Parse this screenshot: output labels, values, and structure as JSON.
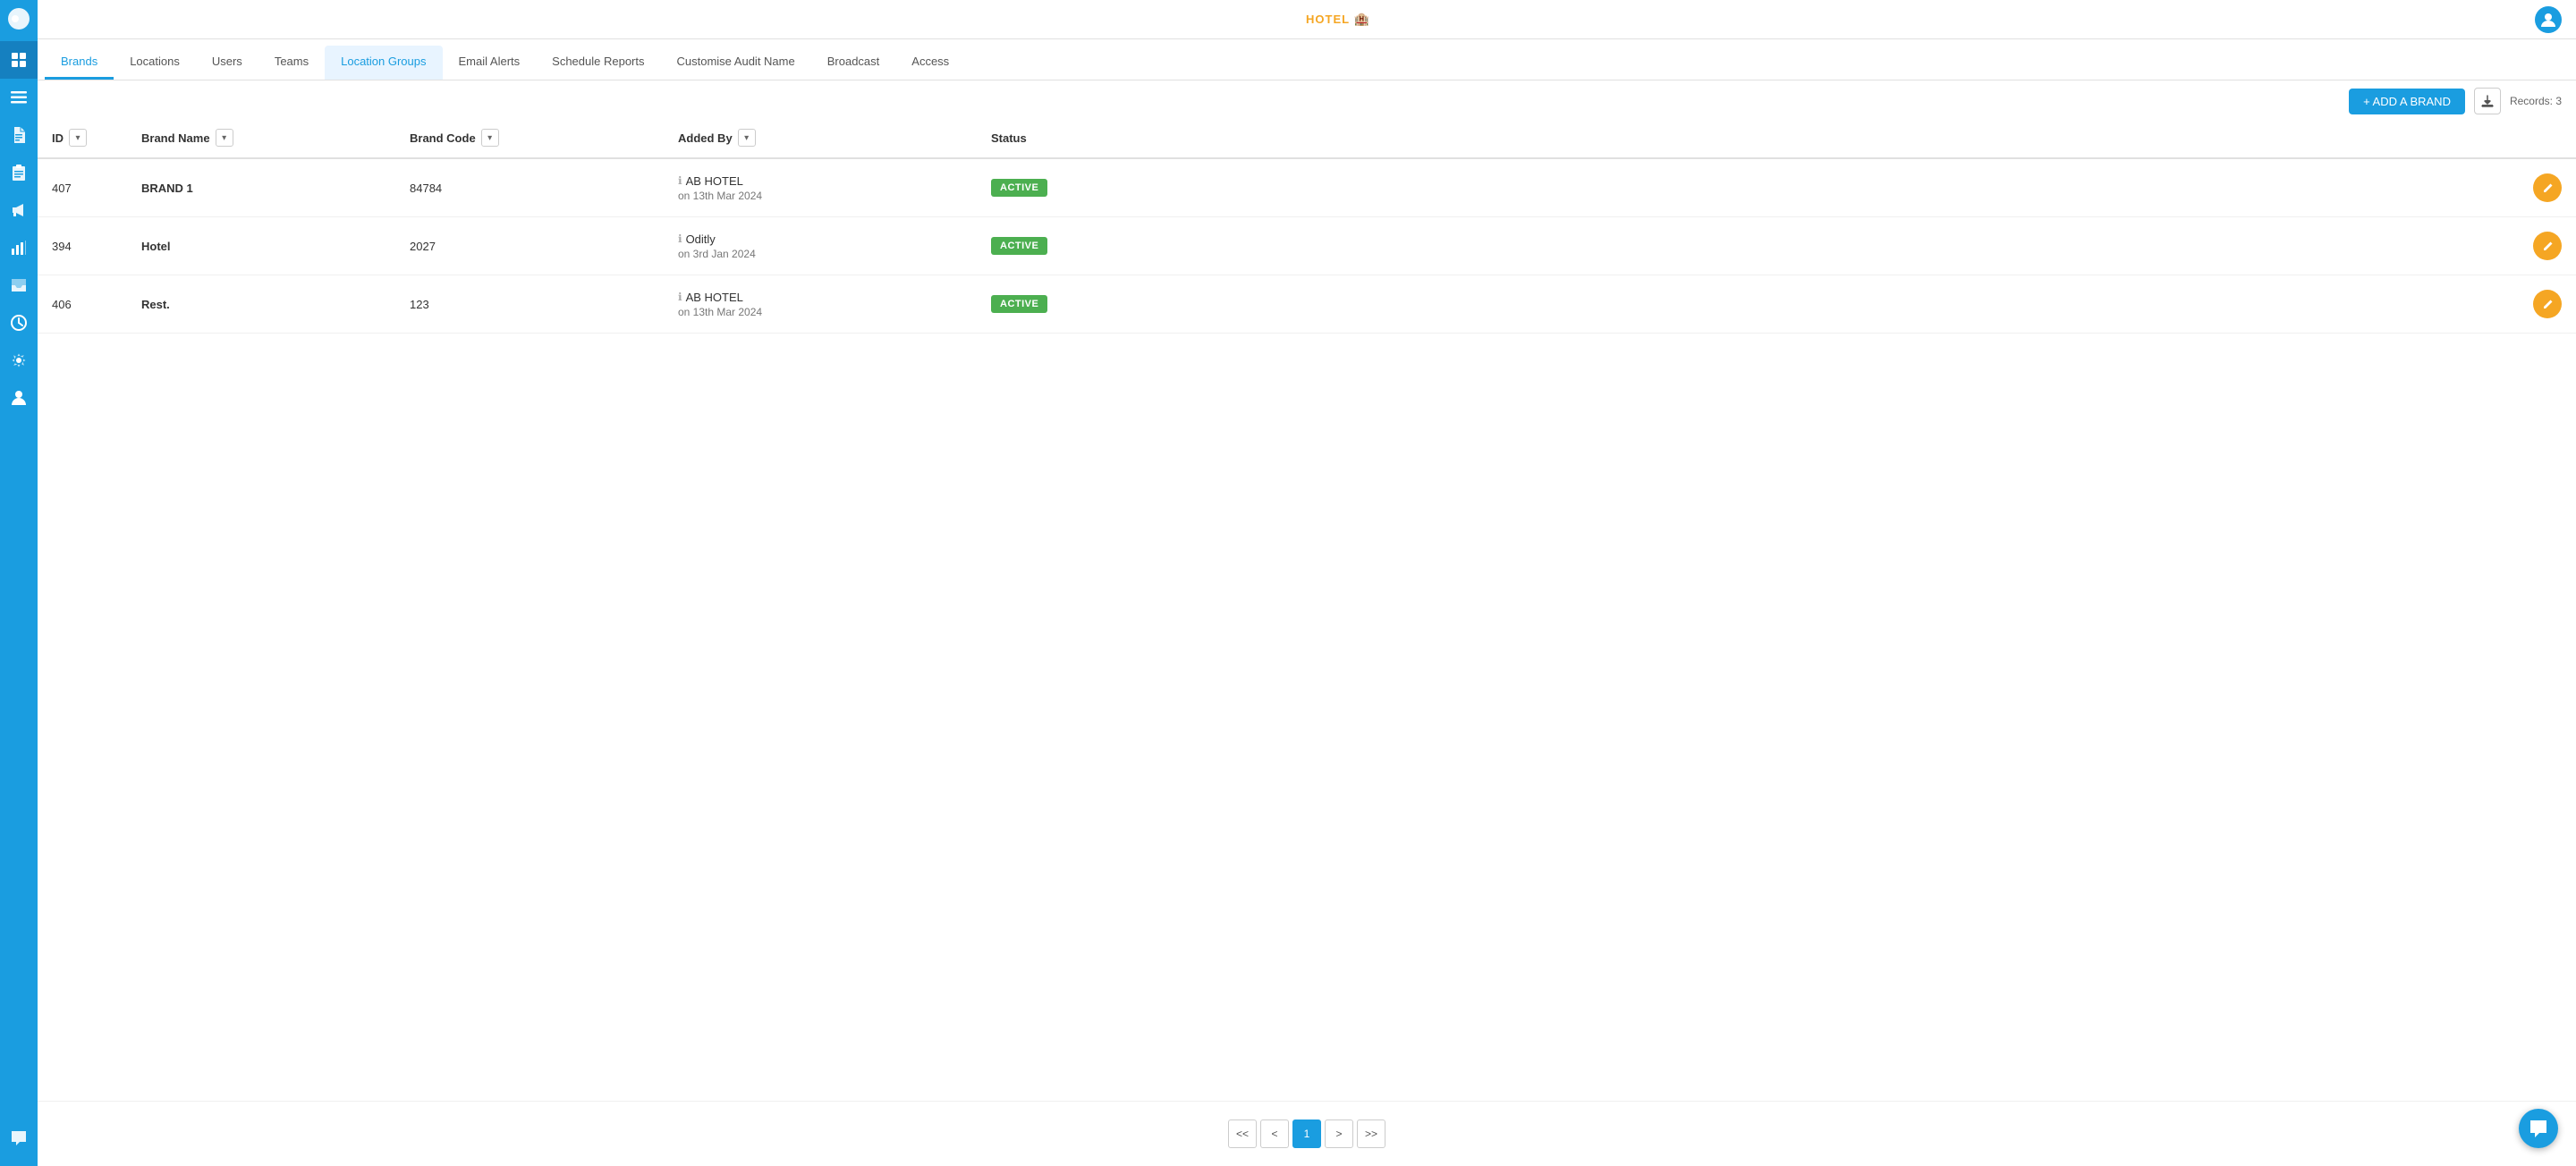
{
  "app": {
    "logo_text": "HOTEL",
    "logo_sub": "🏨"
  },
  "nav": {
    "tabs": [
      {
        "id": "brands",
        "label": "Brands",
        "active": true,
        "highlighted": false
      },
      {
        "id": "locations",
        "label": "Locations",
        "active": false,
        "highlighted": false
      },
      {
        "id": "users",
        "label": "Users",
        "active": false,
        "highlighted": false
      },
      {
        "id": "teams",
        "label": "Teams",
        "active": false,
        "highlighted": false
      },
      {
        "id": "location-groups",
        "label": "Location Groups",
        "active": false,
        "highlighted": true
      },
      {
        "id": "email-alerts",
        "label": "Email Alerts",
        "active": false,
        "highlighted": false
      },
      {
        "id": "schedule-reports",
        "label": "Schedule Reports",
        "active": false,
        "highlighted": false
      },
      {
        "id": "customise-audit-name",
        "label": "Customise Audit Name",
        "active": false,
        "highlighted": false
      },
      {
        "id": "broadcast",
        "label": "Broadcast",
        "active": false,
        "highlighted": false
      },
      {
        "id": "access",
        "label": "Access",
        "active": false,
        "highlighted": false
      }
    ]
  },
  "toolbar": {
    "add_brand_label": "+ ADD A BRAND",
    "records_label": "Records: 3",
    "download_icon": "⬇"
  },
  "table": {
    "columns": [
      {
        "id": "id",
        "label": "ID"
      },
      {
        "id": "brand-name",
        "label": "Brand Name"
      },
      {
        "id": "brand-code",
        "label": "Brand Code"
      },
      {
        "id": "added-by",
        "label": "Added By"
      },
      {
        "id": "status",
        "label": "Status"
      }
    ],
    "rows": [
      {
        "id": "407",
        "brand_name": "BRAND 1",
        "brand_code": "84784",
        "added_by_name": "AB HOTEL",
        "added_by_date": "on 13th Mar 2024",
        "status": "ACTIVE"
      },
      {
        "id": "394",
        "brand_name": "Hotel",
        "brand_code": "2027",
        "added_by_name": "Oditly",
        "added_by_date": "on 3rd Jan 2024",
        "status": "ACTIVE"
      },
      {
        "id": "406",
        "brand_name": "Rest.",
        "brand_code": "123",
        "added_by_name": "AB HOTEL",
        "added_by_date": "on 13th Mar 2024",
        "status": "ACTIVE"
      }
    ]
  },
  "pagination": {
    "first_label": "<<",
    "prev_label": "<",
    "current_page": "1",
    "next_label": ">",
    "last_label": ">>"
  },
  "sidebar": {
    "icons": [
      {
        "id": "grid-icon",
        "symbol": "⊞",
        "active": true
      },
      {
        "id": "list-icon",
        "symbol": "☰",
        "active": false
      },
      {
        "id": "doc-icon",
        "symbol": "📄",
        "active": false
      },
      {
        "id": "clipboard-icon",
        "symbol": "📋",
        "active": false
      },
      {
        "id": "megaphone-icon",
        "symbol": "📣",
        "active": false
      },
      {
        "id": "chart-icon",
        "symbol": "📊",
        "active": false
      },
      {
        "id": "inbox-icon",
        "symbol": "📥",
        "active": false
      },
      {
        "id": "clock-icon",
        "symbol": "🕐",
        "active": false
      },
      {
        "id": "gear-icon",
        "symbol": "⚙",
        "active": false
      },
      {
        "id": "person-icon",
        "symbol": "👤",
        "active": false
      }
    ],
    "chat_icon": "💬"
  }
}
